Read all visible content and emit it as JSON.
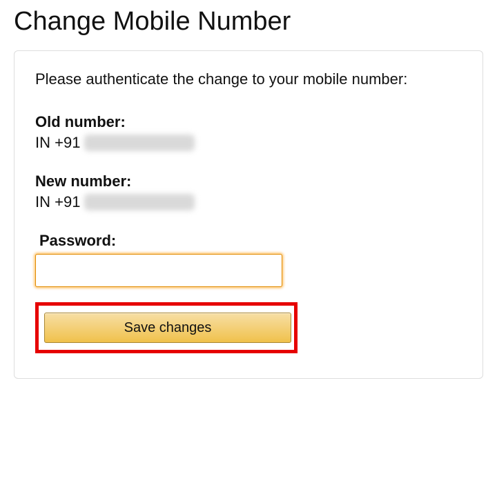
{
  "title": "Change Mobile Number",
  "instructions": "Please authenticate the change to your mobile number:",
  "old_number": {
    "label": "Old number:",
    "prefix": "IN +91"
  },
  "new_number": {
    "label": "New number:",
    "prefix": "IN +91"
  },
  "password": {
    "label": "Password:",
    "value": ""
  },
  "save_button": "Save changes"
}
